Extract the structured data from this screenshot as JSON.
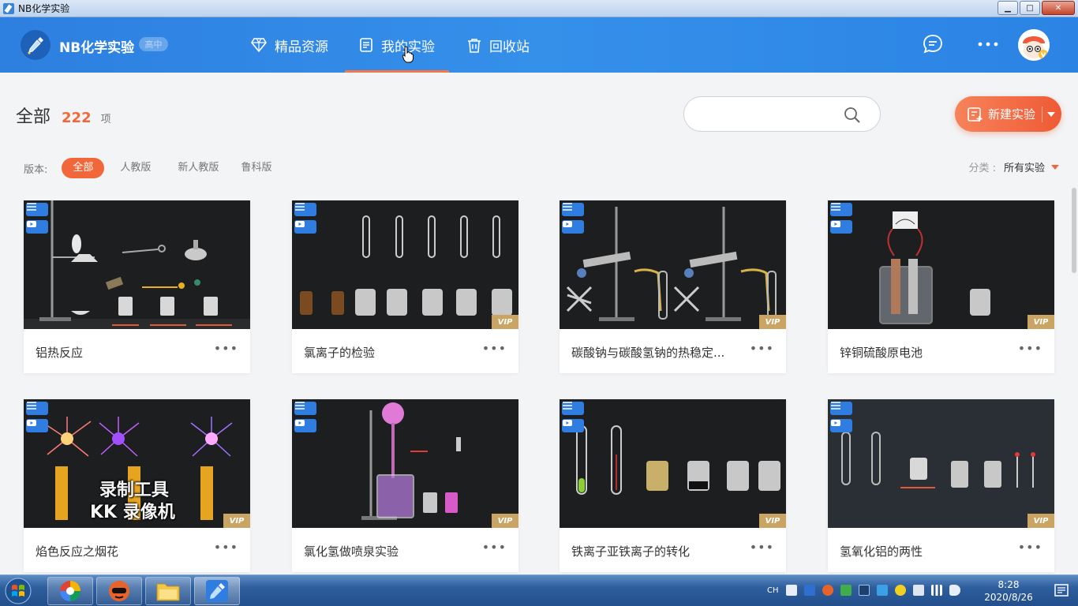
{
  "window": {
    "title": "NB化学实验",
    "minimize": "▁",
    "maximize": "□",
    "close": "✕"
  },
  "header": {
    "app_name": "NB化学实验",
    "badge": "高中",
    "nav": [
      {
        "label": "精品资源",
        "icon": "diamond-icon"
      },
      {
        "label": "我的实验",
        "icon": "notebook-icon",
        "active": true
      },
      {
        "label": "回收站",
        "icon": "trash-icon"
      }
    ],
    "accent_color": "#f2784b"
  },
  "page": {
    "title": "全部",
    "count": "222",
    "unit": "项",
    "search_placeholder": "",
    "new_button": "新建实验",
    "version_label": "版本:",
    "filters": [
      "全部",
      "人教版",
      "新人教版",
      "鲁科版"
    ],
    "category_label": "分类 :",
    "category_value": "所有实验"
  },
  "cards": [
    {
      "title": "铝热反应",
      "vip": false
    },
    {
      "title": "氯离子的检验",
      "vip": true
    },
    {
      "title": "碳酸钠与碳酸氢钠的热稳定...",
      "vip": true
    },
    {
      "title": "锌铜硫酸原电池",
      "vip": true
    },
    {
      "title": "焰色反应之烟花",
      "vip": true
    },
    {
      "title": "氯化氢做喷泉实验",
      "vip": true
    },
    {
      "title": "铁离子亚铁离子的转化",
      "vip": true
    },
    {
      "title": "氢氧化铝的两性",
      "vip": true
    }
  ],
  "vip_label": "VIP",
  "more_label": "•••",
  "watermark": {
    "line1": "录制工具",
    "line2": "KK 录像机"
  },
  "taskbar": {
    "lang": "CH",
    "time": "8:28",
    "date": "2020/8/26"
  }
}
